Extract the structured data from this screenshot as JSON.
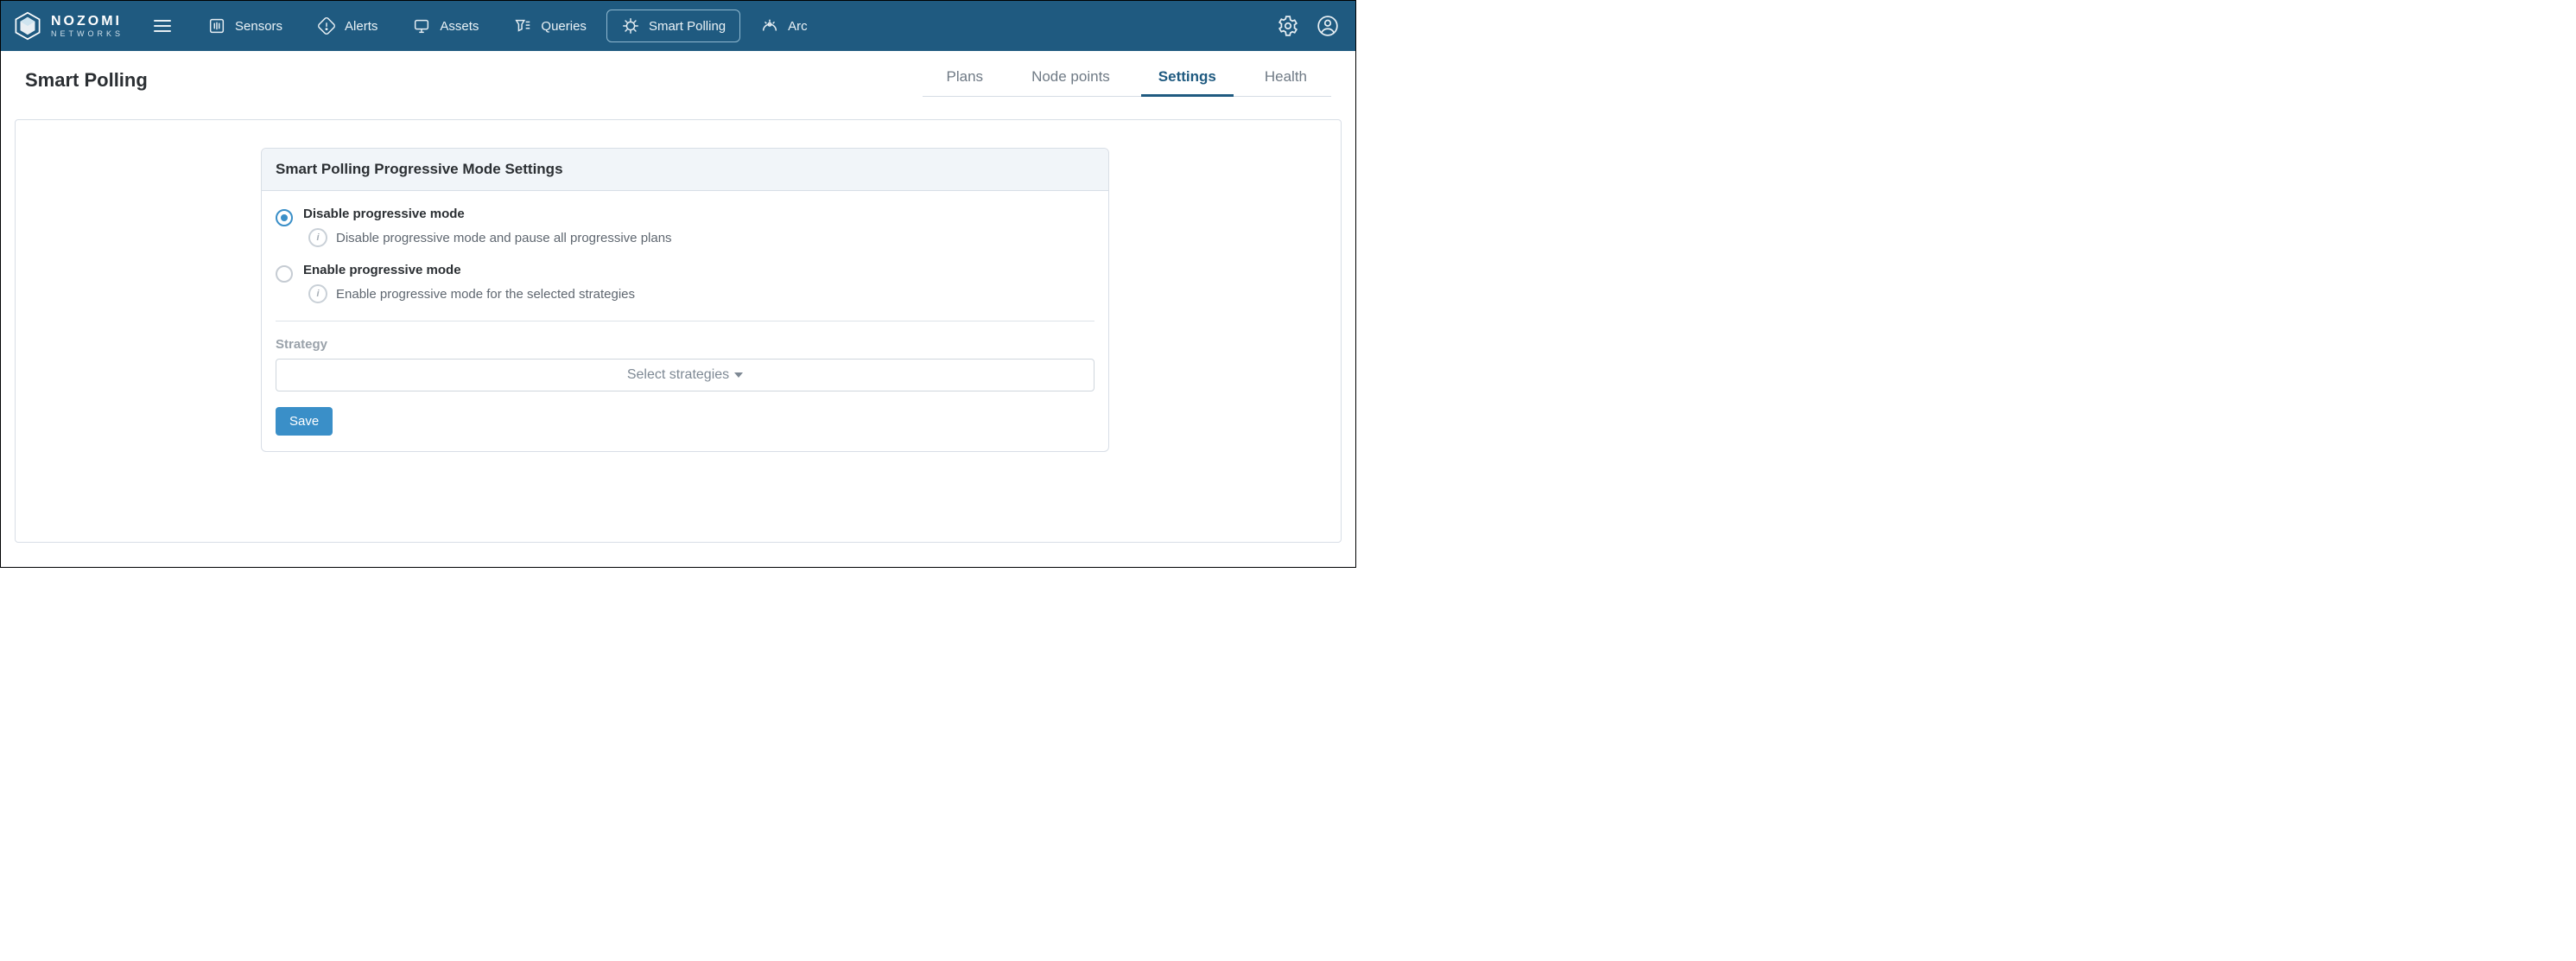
{
  "brand": {
    "name": "NOZOMI",
    "sub": "NETWORKS"
  },
  "nav": {
    "items": [
      {
        "label": "Sensors"
      },
      {
        "label": "Alerts"
      },
      {
        "label": "Assets"
      },
      {
        "label": "Queries"
      },
      {
        "label": "Smart Polling"
      },
      {
        "label": "Arc"
      }
    ]
  },
  "page": {
    "title": "Smart Polling"
  },
  "tabs": [
    {
      "label": "Plans"
    },
    {
      "label": "Node points"
    },
    {
      "label": "Settings"
    },
    {
      "label": "Health"
    }
  ],
  "settings_panel": {
    "title": "Smart Polling Progressive Mode Settings",
    "options": [
      {
        "label": "Disable progressive mode",
        "desc": "Disable progressive mode and pause all progressive plans"
      },
      {
        "label": "Enable progressive mode",
        "desc": "Enable progressive mode for the selected strategies"
      }
    ],
    "selected_option_index": 0,
    "strategy_field": {
      "label": "Strategy",
      "placeholder": "Select strategies"
    },
    "save_label": "Save"
  }
}
